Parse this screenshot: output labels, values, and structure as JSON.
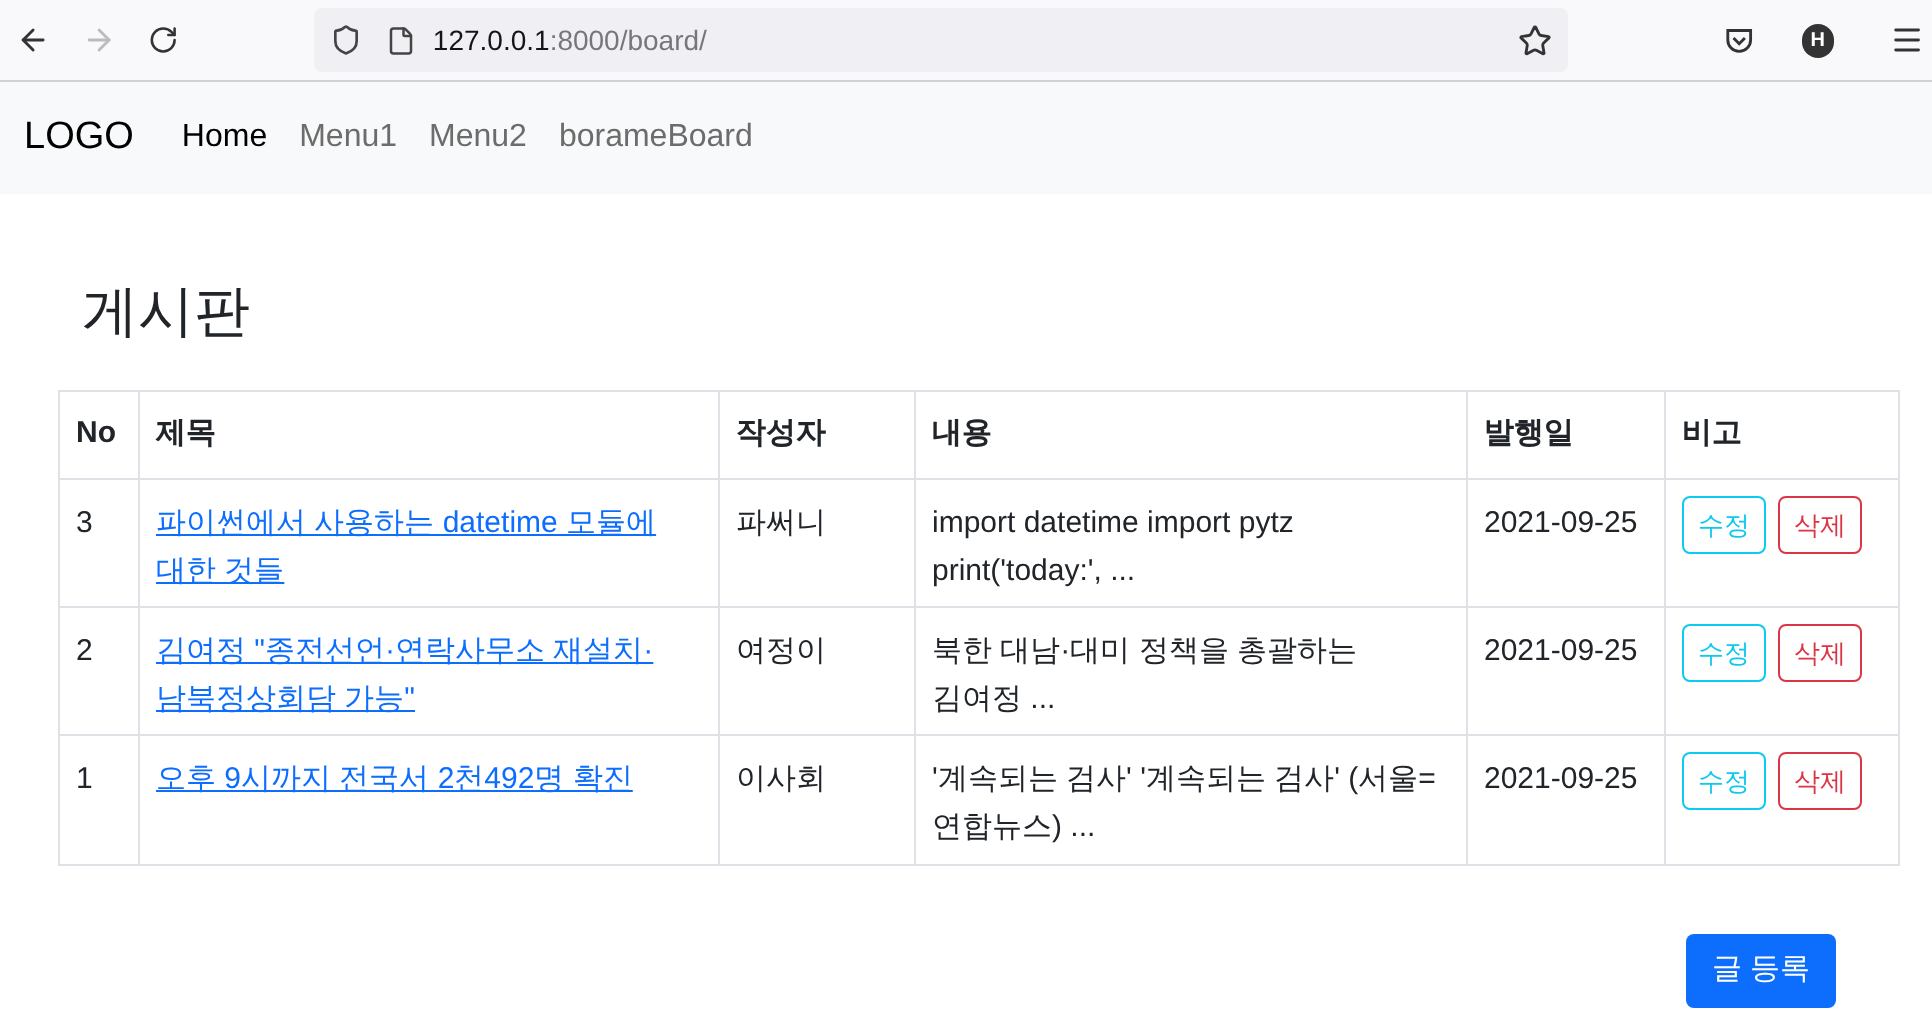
{
  "browser": {
    "url_host": "127.0.0.1",
    "url_path": ":8000/board/",
    "profile_initial": "H"
  },
  "navbar": {
    "logo": "LOGO",
    "items": [
      {
        "label": "Home",
        "selected": true
      },
      {
        "label": "Menu1",
        "selected": false
      },
      {
        "label": "Menu2",
        "selected": false
      },
      {
        "label": "borameBoard",
        "selected": false
      }
    ]
  },
  "page_title": "게시판",
  "table": {
    "columns": [
      "No",
      "제목",
      "작성자",
      "내용",
      "발행일",
      "비고"
    ],
    "rows": [
      {
        "no": "3",
        "title": "파이썬에서 사용하는 datetime 모듈에 대한 것들",
        "author": "파써니",
        "content": "import datetime import pytz print('today:', ...",
        "date": "2021-09-25",
        "actions": [
          "수정",
          "삭제"
        ]
      },
      {
        "no": "2",
        "title": "김여정 \"종전선언·연락사무소 재설치·남북정상회담 가능\"",
        "author": "여정이",
        "content": "북한 대남·대미 정책을 총괄하는 김여정 ...",
        "date": "2021-09-25",
        "actions": [
          "수정",
          "삭제"
        ]
      },
      {
        "no": "1",
        "title": "오후 9시까지 전국서 2천492명 확진",
        "author": "이사회",
        "content": "'계속되는 검사' '계속되는 검사' (서울=연합뉴스) ...",
        "date": "2021-09-25",
        "actions": [
          "수정",
          "삭제"
        ]
      }
    ]
  },
  "create_button": "글 등록"
}
